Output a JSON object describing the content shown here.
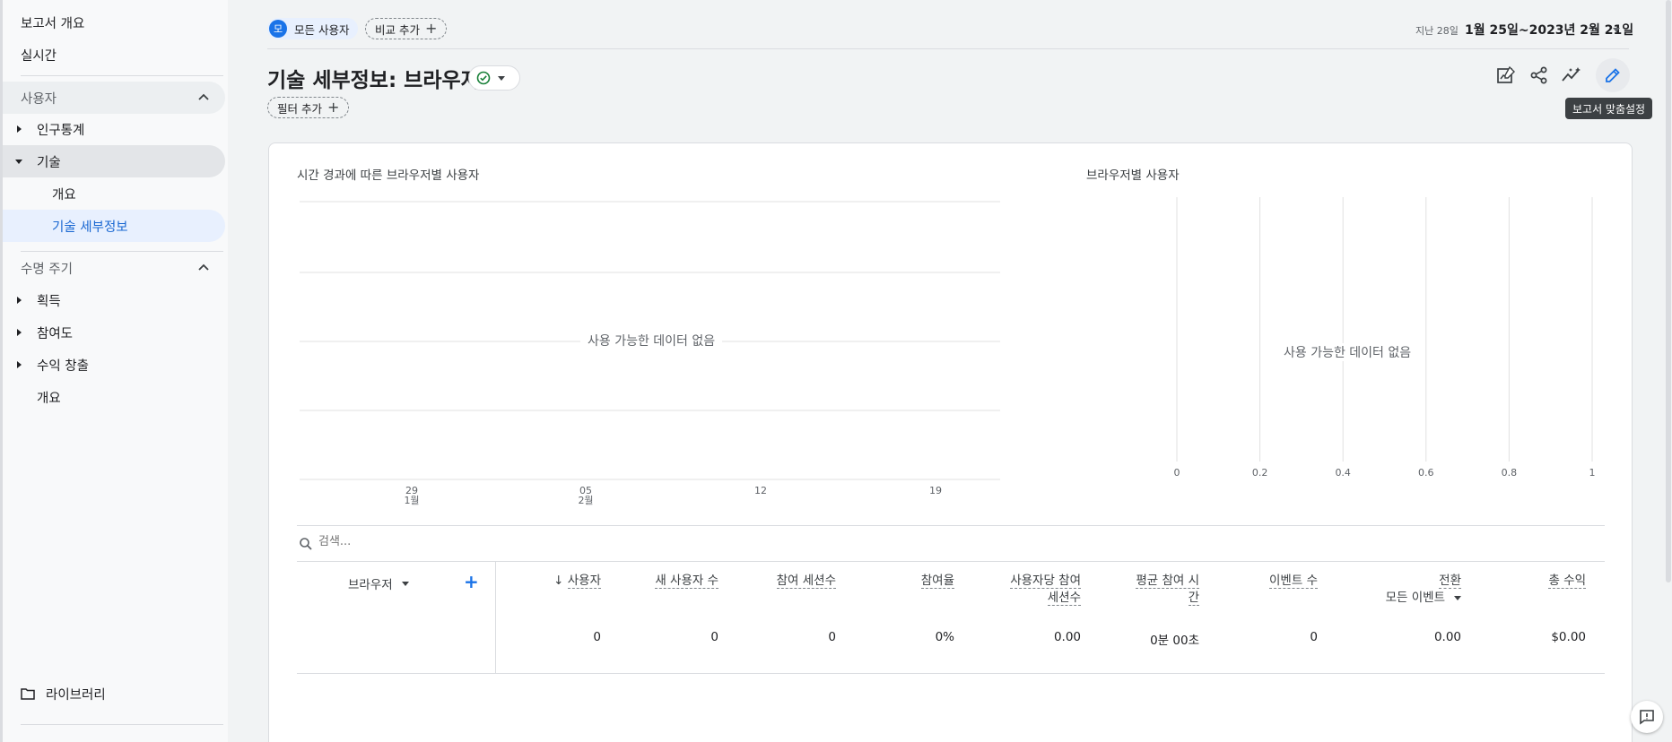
{
  "sidebar": {
    "top_items": [
      {
        "label": "보고서 개요"
      },
      {
        "label": "실시간"
      }
    ],
    "sections": [
      {
        "label": "사용자"
      },
      {
        "label": "수명 주기"
      }
    ],
    "user_items": {
      "demographics": "인구통계",
      "tech": "기술",
      "tech_overview": "개요",
      "tech_details": "기술 세부정보"
    },
    "lifecycle_items": {
      "acquisition": "획득",
      "engagement": "참여도",
      "monetization": "수익 창출",
      "overview": "개요"
    },
    "library": "라이브러리"
  },
  "header": {
    "segment_badge": "모",
    "segment_label": "모든 사용자",
    "compare_label": "비교 추가",
    "date_label": "지난 28일",
    "date_range": "1월 25일~2023년 2월 21일",
    "title": "기술 세부정보: 브라우저",
    "filter_label": "필터 추가",
    "tooltip": "보고서 맞춤설정"
  },
  "chart_data": [
    {
      "type": "line",
      "title": "시간 경과에 따른 브라우저별 사용자",
      "x_ticks": [
        {
          "top": "29",
          "bottom": "1월"
        },
        {
          "top": "05",
          "bottom": "2월"
        },
        {
          "top": "12",
          "bottom": ""
        },
        {
          "top": "19",
          "bottom": ""
        }
      ],
      "series": [],
      "empty_message": "사용 가능한 데이터 없음"
    },
    {
      "type": "bar",
      "title": "브라우저별 사용자",
      "x_ticks": [
        "0",
        "0.2",
        "0.4",
        "0.6",
        "0.8",
        "1"
      ],
      "xlim": [
        0,
        1
      ],
      "series": [],
      "empty_message": "사용 가능한 데이터 없음"
    }
  ],
  "table": {
    "search_placeholder": "검색...",
    "dimension": "브라우저",
    "columns": [
      {
        "line1": "사용자",
        "line2": "",
        "value": "0",
        "sorted": true
      },
      {
        "line1": "새 사용자 수",
        "line2": "",
        "value": "0"
      },
      {
        "line1": "참여 세션수",
        "line2": "",
        "value": "0"
      },
      {
        "line1": "참여율",
        "line2": "",
        "value": "0%"
      },
      {
        "line1": "사용자당 참여",
        "line2": "세션수",
        "value": "0.00"
      },
      {
        "line1": "평균 참여 시",
        "line2": "간",
        "value": "0분 00초"
      },
      {
        "line1": "이벤트 수",
        "line2": "",
        "value": "0"
      },
      {
        "line1": "전환",
        "line2": "모든 이벤트",
        "value": "0.00"
      },
      {
        "line1": "총 수익",
        "line2": "",
        "value": "$0.00"
      }
    ]
  }
}
